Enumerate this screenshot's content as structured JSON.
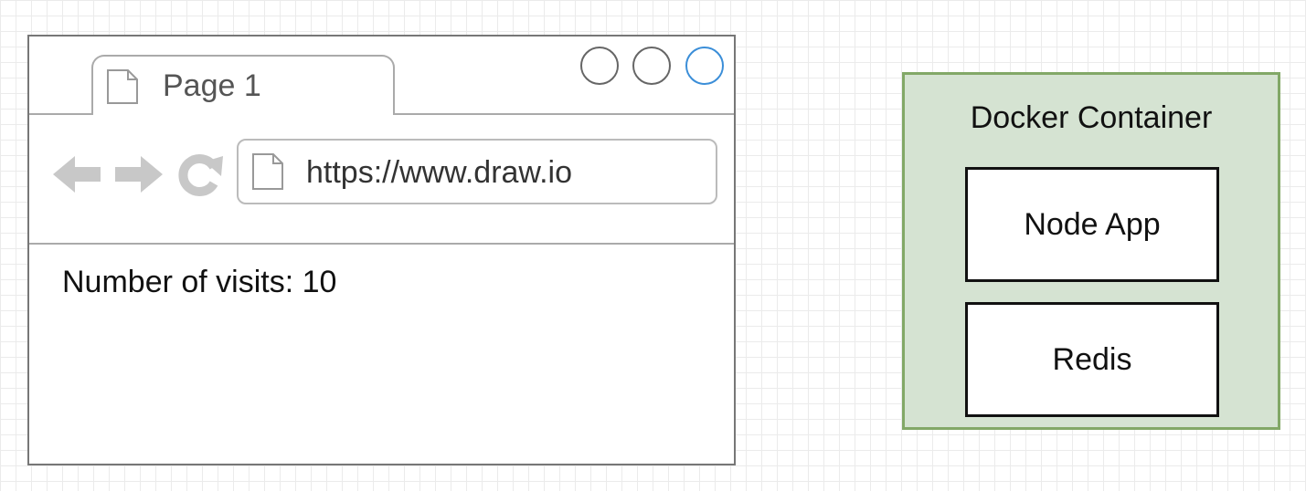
{
  "browser": {
    "tab_label": "Page 1",
    "url": "https://www.draw.io",
    "content_text": "Number of visits: 10",
    "window_buttons": [
      {
        "name": "close",
        "color": "#666666"
      },
      {
        "name": "minimize",
        "color": "#666666"
      },
      {
        "name": "maximize",
        "color": "#3b8ed8"
      }
    ],
    "nav_icons": [
      "back-arrow-icon",
      "forward-arrow-icon",
      "reload-icon"
    ]
  },
  "docker": {
    "title": "Docker Container",
    "services": [
      {
        "label": "Node App"
      },
      {
        "label": "Redis"
      }
    ],
    "fill_color": "#d5e3d2",
    "border_color": "#82a867"
  }
}
